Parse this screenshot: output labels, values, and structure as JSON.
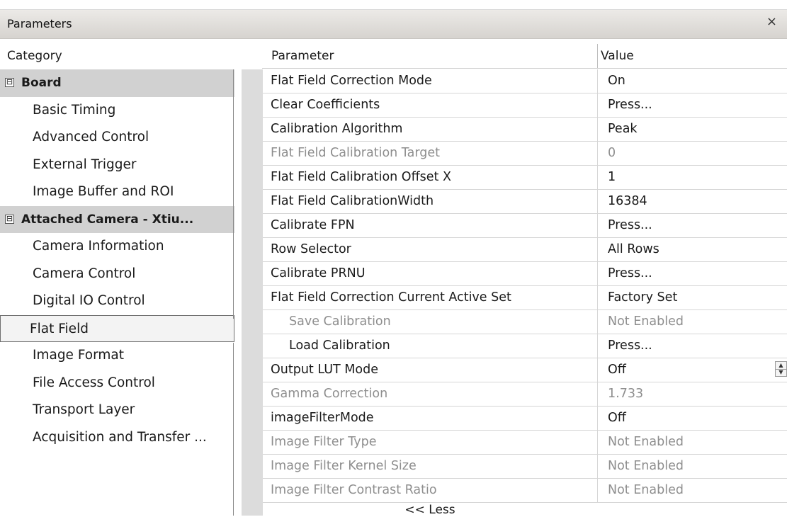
{
  "window": {
    "title": "Parameters",
    "close_glyph": "×"
  },
  "headers": {
    "category": "Category",
    "parameter": "Parameter",
    "value": "Value"
  },
  "categories": [
    {
      "label": "Board",
      "type": "group",
      "toggle": "⊟"
    },
    {
      "label": "Basic Timing",
      "type": "item"
    },
    {
      "label": "Advanced Control",
      "type": "item"
    },
    {
      "label": "External Trigger",
      "type": "item"
    },
    {
      "label": "Image Buffer and ROI",
      "type": "item"
    },
    {
      "label": "Attached Camera - Xtiu...",
      "type": "group",
      "toggle": "⊟"
    },
    {
      "label": "Camera Information",
      "type": "item"
    },
    {
      "label": "Camera Control",
      "type": "item"
    },
    {
      "label": "Digital IO Control",
      "type": "item"
    },
    {
      "label": "Flat Field",
      "type": "item",
      "selected": true
    },
    {
      "label": "Image Format",
      "type": "item"
    },
    {
      "label": "File Access Control",
      "type": "item"
    },
    {
      "label": "Transport Layer",
      "type": "item"
    },
    {
      "label": "Acquisition and Transfer ...",
      "type": "item"
    }
  ],
  "parameters": [
    {
      "name": "Flat Field Correction Mode",
      "value": "On"
    },
    {
      "name": "Clear Coefficients",
      "value": "Press..."
    },
    {
      "name": "Calibration Algorithm",
      "value": "Peak"
    },
    {
      "name": "Flat Field Calibration Target",
      "value": "0",
      "disabled": true
    },
    {
      "name": "Flat Field Calibration Offset X",
      "value": "1"
    },
    {
      "name": "Flat Field CalibrationWidth",
      "value": "16384"
    },
    {
      "name": "Calibrate FPN",
      "value": "Press..."
    },
    {
      "name": "Row Selector",
      "value": "All Rows"
    },
    {
      "name": "Calibrate PRNU",
      "value": "Press..."
    },
    {
      "name": "Flat Field Correction Current Active Set",
      "value": "Factory Set"
    },
    {
      "name": "Save Calibration",
      "value": "Not Enabled",
      "disabled": true,
      "indent": true
    },
    {
      "name": "Load Calibration",
      "value": "Press...",
      "indent": true
    },
    {
      "name": "Output LUT Mode",
      "value": "Off",
      "spinner": true
    },
    {
      "name": "Gamma Correction",
      "value": "1.733",
      "disabled": true
    },
    {
      "name": "imageFilterMode",
      "value": "Off"
    },
    {
      "name": "Image Filter Type",
      "value": "Not Enabled",
      "disabled": true
    },
    {
      "name": "Image Filter Kernel Size",
      "value": "Not Enabled",
      "disabled": true
    },
    {
      "name": "Image Filter Contrast Ratio",
      "value": "Not Enabled",
      "disabled": true
    }
  ],
  "spinner_icons": {
    "up": "▲",
    "down": "▼"
  },
  "footer": {
    "less_label": "<< Less"
  }
}
